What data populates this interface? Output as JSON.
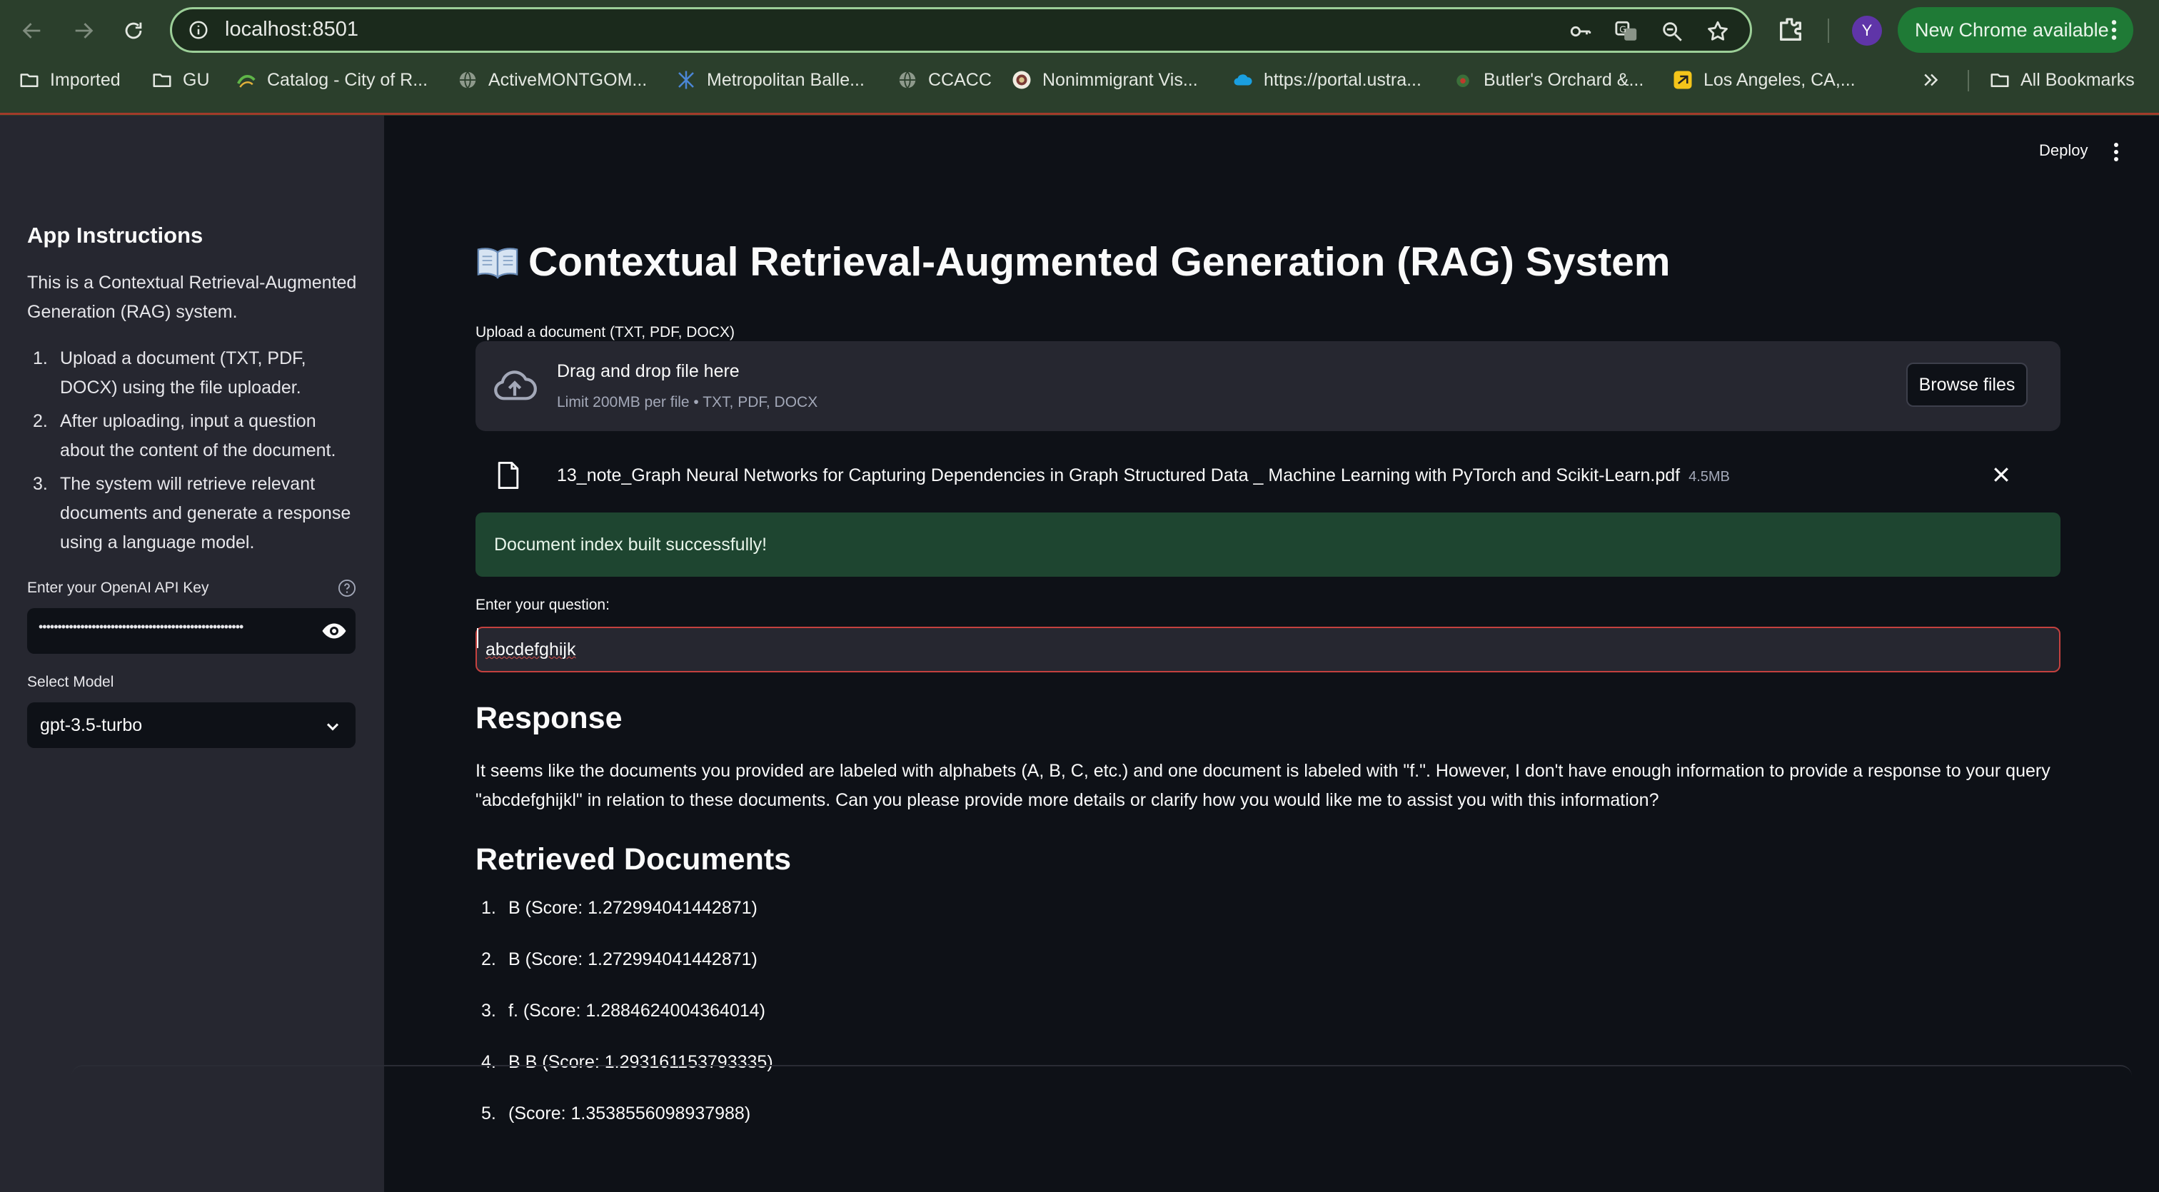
{
  "browser": {
    "url": "localhost:8501",
    "update_label": "New Chrome available",
    "avatar_letter": "Y",
    "bookmarks": [
      {
        "label": "Imported",
        "icon": "folder-icon"
      },
      {
        "label": "GU",
        "icon": "folder-icon"
      },
      {
        "label": "Catalog - City of R...",
        "icon": "city-logo-icon"
      },
      {
        "label": "ActiveMONTGOM...",
        "icon": "globe-icon"
      },
      {
        "label": "Metropolitan Balle...",
        "icon": "ballet-logo-icon"
      },
      {
        "label": "CCACC",
        "icon": "globe-icon"
      },
      {
        "label": "Nonimmigrant Vis...",
        "icon": "seal-icon"
      },
      {
        "label": "https://portal.ustra...",
        "icon": "cloud-logo-icon"
      },
      {
        "label": "Butler's Orchard &...",
        "icon": "orchard-logo-icon"
      },
      {
        "label": "Los Angeles, CA,...",
        "icon": "yellow-app-icon"
      }
    ],
    "all_bookmarks_label": "All Bookmarks"
  },
  "sidebar": {
    "title": "App Instructions",
    "intro": "This is a Contextual Retrieval-Augmented Generation (RAG) system.",
    "steps": [
      {
        "num": "1.",
        "text": "Upload a document (TXT, PDF, DOCX) using the file uploader."
      },
      {
        "num": "2.",
        "text": "After uploading, input a question about the content of the document."
      },
      {
        "num": "3.",
        "text": "The system will retrieve relevant documents and generate a response using a language model."
      }
    ],
    "api_key_label": "Enter your OpenAI API Key",
    "api_key_masked": "••••••••••••••••••••••••••••••••••••••••••••••••••••••",
    "model_label": "Select Model",
    "model_value": "gpt-3.5-turbo"
  },
  "main": {
    "deploy_label": "Deploy",
    "title": "Contextual Retrieval-Augmented Generation (RAG) System",
    "upload_label": "Upload a document (TXT, PDF, DOCX)",
    "dropzone_title": "Drag and drop file here",
    "dropzone_limit": "Limit 200MB per file • TXT, PDF, DOCX",
    "browse_label": "Browse files",
    "file_name": "13_note_Graph Neural Networks for Capturing Dependencies in Graph Structured Data _ Machine Learning with PyTorch and Scikit-Learn.pdf",
    "file_size": "4.5MB",
    "success_message": "Document index built successfully!",
    "question_label": "Enter your question:",
    "question_value": "abcdefghijk",
    "response_heading": "Response",
    "response_text": "It seems like the documents you provided are labeled with alphabets (A, B, C, etc.) and one document is labeled with \"f.\". However, I don't have enough information to provide a response to your query \"abcdefghijkl\" in relation to these documents. Can you please provide more details or clarify how you would like me to assist you with this information?",
    "docs_heading": "Retrieved Documents",
    "docs": [
      {
        "num": "1.",
        "text": "B (Score: 1.272994041442871)"
      },
      {
        "num": "2.",
        "text": "B (Score: 1.272994041442871)"
      },
      {
        "num": "3.",
        "text": "f. (Score: 1.2884624004364014)"
      },
      {
        "num": "4.",
        "text": "B B (Score: 1.293161153793335)"
      },
      {
        "num": "5.",
        "text": "(Score: 1.3538556098937988)"
      }
    ]
  },
  "colors": {
    "browser_frame": "#2b3f2c",
    "sidebar_bg": "#262730",
    "main_bg": "#0e1117",
    "success_bg": "#1e4530",
    "input_focus_border": "#c4413f",
    "update_chip": "#1f7a36"
  }
}
